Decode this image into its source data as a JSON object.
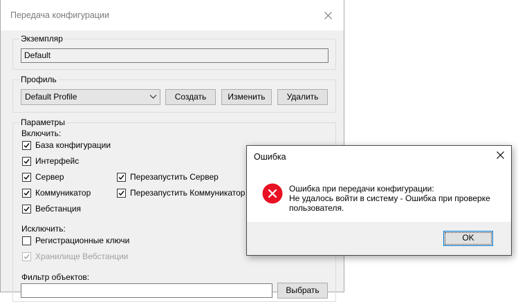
{
  "main_window": {
    "title": "Передача конфигурации",
    "instance": {
      "legend": "Экземпляр",
      "value": "Default"
    },
    "profile": {
      "legend": "Профиль",
      "selected": "Default Profile",
      "create_label": "Создать",
      "edit_label": "Изменить",
      "delete_label": "Удалить"
    },
    "params": {
      "legend": "Параметры",
      "include_label": "Включить:",
      "include_items": [
        {
          "label": "База конфигурации",
          "checked": true
        },
        {
          "label": "Интерфейс",
          "checked": true
        },
        {
          "label": "Сервер",
          "checked": true
        },
        {
          "label": "Коммуникатор",
          "checked": true
        },
        {
          "label": "Вебстанция",
          "checked": true
        },
        {
          "label": "Перезапустить Сервер",
          "checked": true
        },
        {
          "label": "Перезапустить Коммуникатор",
          "checked": true
        }
      ],
      "exclude_label": "Исключить:",
      "exclude_items": [
        {
          "label": "Регистрационные ключи",
          "checked": false
        },
        {
          "label": "Хранилище Вебстанции",
          "checked": true,
          "disabled": true
        }
      ],
      "filter_label": "Фильтр объектов:",
      "filter_value": "",
      "select_label": "Выбрать"
    }
  },
  "error_dialog": {
    "title": "Ошибка",
    "message_lines": [
      "Ошибка при передачи конфигурации:",
      "Не удалось войти в систему - Ошибка при проверке",
      "пользователя."
    ],
    "ok_label": "OK"
  },
  "icons": {
    "close": "close-icon",
    "dropdown": "chevron-down-icon",
    "checkmark": "checkmark-icon",
    "error": "error-icon"
  },
  "colors": {
    "error_red": "#e81123",
    "focus_blue": "#0078d7",
    "window_bg": "#f0f0f0",
    "disabled_text": "#a0a0a0"
  }
}
